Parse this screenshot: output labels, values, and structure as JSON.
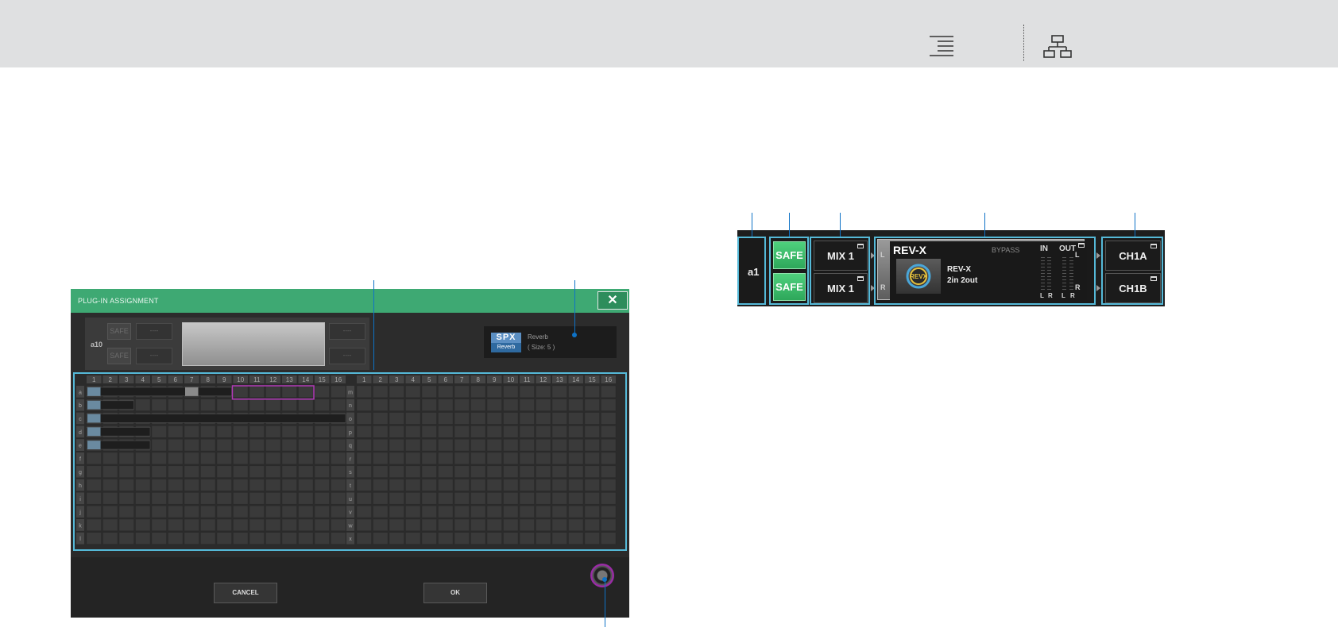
{
  "topbar": {
    "icons": [
      "align-right-lines-icon",
      "hierarchy-network-icon"
    ]
  },
  "dialog": {
    "title": "PLUG-IN ASSIGNMENT",
    "close_label": "✕",
    "rack_label": "a10",
    "safe_label": "SAFE",
    "slot_label": "----",
    "selected_plugin": {
      "logo_top": "SPX",
      "logo_bottom": "Reverb",
      "name": "Reverb",
      "size": "( Size: 5 )"
    },
    "grid": {
      "columns": [
        "1",
        "2",
        "3",
        "4",
        "5",
        "6",
        "7",
        "8",
        "9",
        "10",
        "11",
        "12",
        "13",
        "14",
        "15",
        "16"
      ],
      "left_rows": [
        "a",
        "b",
        "c",
        "d",
        "e",
        "f",
        "g",
        "h",
        "i",
        "j",
        "k",
        "l"
      ],
      "right_rows": [
        "m",
        "n",
        "o",
        "p",
        "q",
        "r",
        "s",
        "t",
        "u",
        "v",
        "w",
        "x"
      ]
    },
    "cancel_label": "CANCEL",
    "ok_label": "OK"
  },
  "strip": {
    "rack": "a1",
    "safe_top": "SAFE",
    "safe_bottom": "SAFE",
    "input_l": "MIX 1",
    "input_r": "MIX 1",
    "plugin_title": "REV-X",
    "bypass": "BYPASS",
    "plugin_name": "REV-X",
    "plugin_io": "2in 2out",
    "in_label": "IN",
    "out_label": "OUT",
    "output_l": "CH1A",
    "output_r": "CH1B",
    "left_l": "L",
    "left_r": "R",
    "right_l": "L",
    "right_r": "R",
    "meter_in_l": "L",
    "meter_in_r": "R",
    "meter_out_l": "L",
    "meter_out_r": "R"
  },
  "colors": {
    "title_green": "#3ea973",
    "safe_green": "#3bbd68",
    "highlight_blue": "#55b9d8",
    "callout_blue": "#0e72c6",
    "selection_magenta": "#b23ab8"
  }
}
